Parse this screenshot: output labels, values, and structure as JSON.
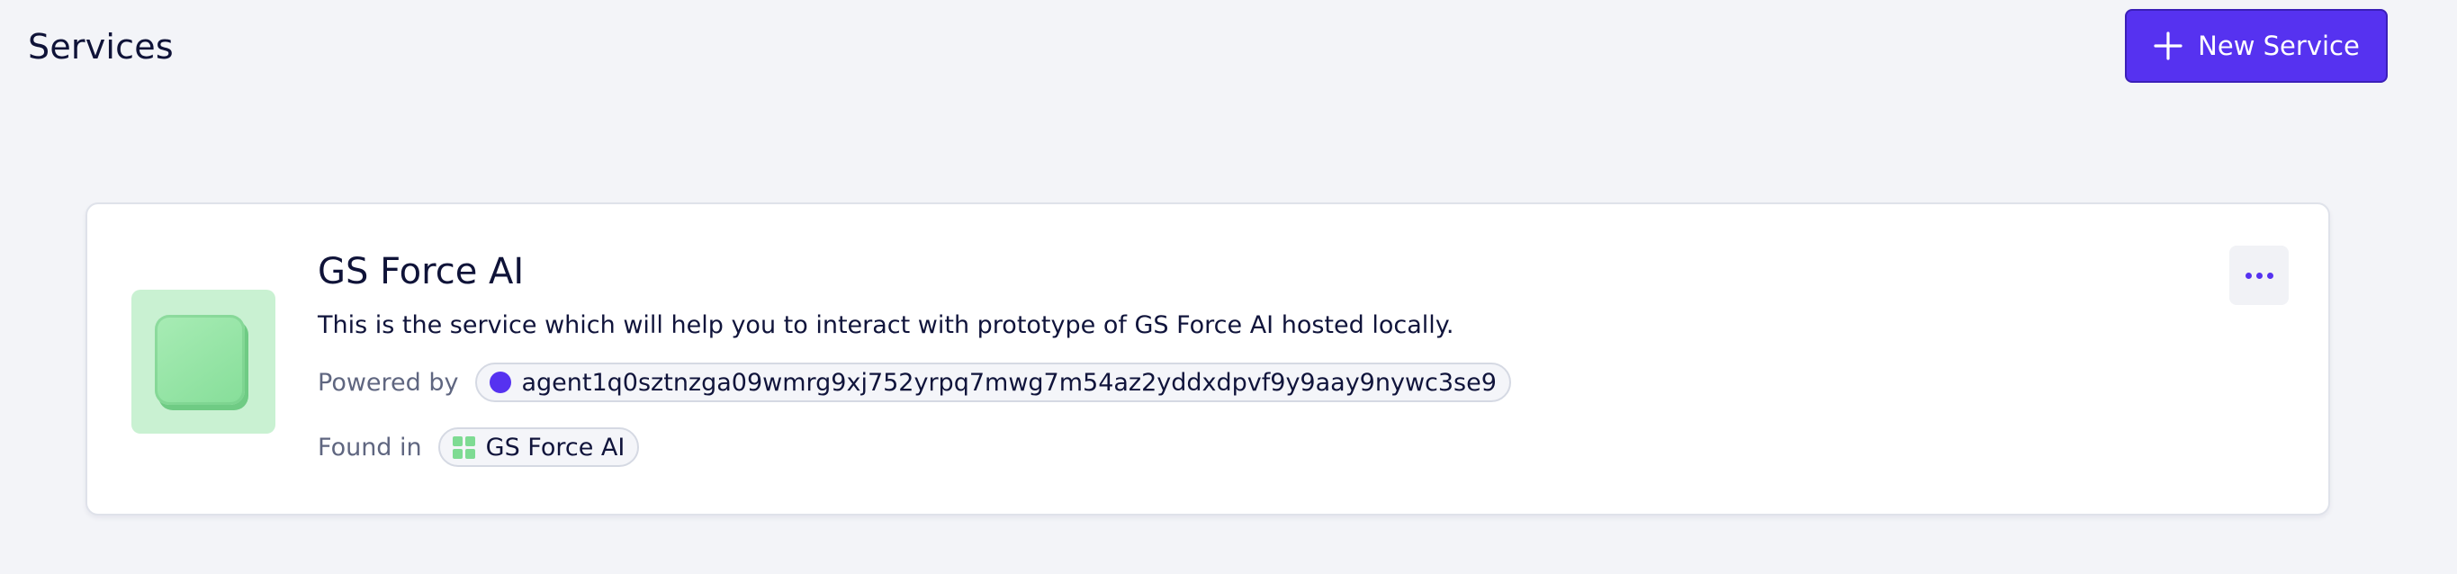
{
  "header": {
    "title": "Services",
    "new_service_label": "New Service",
    "new_service_icon": "plus-icon"
  },
  "colors": {
    "accent": "#5632f0",
    "background": "#f3f4f8",
    "card": "#ffffff",
    "text": "#0f1338",
    "muted": "#5f6680",
    "service_logo": "#c9f1d2"
  },
  "service_card": {
    "name": "GS Force AI",
    "description": "This is the service which will help you to interact with prototype of GS Force AI hosted locally.",
    "powered_by_label": "Powered by",
    "agent_address": "agent1q0sztnzga09wmrg9xj752yrpq7mwg7m54az2yddxdpvf9y9aay9nywc3se9",
    "found_in_label": "Found in",
    "found_in_value": "GS Force AI",
    "more_icon": "more-horizontal-icon",
    "logo_icon": "service-logo-icon"
  }
}
